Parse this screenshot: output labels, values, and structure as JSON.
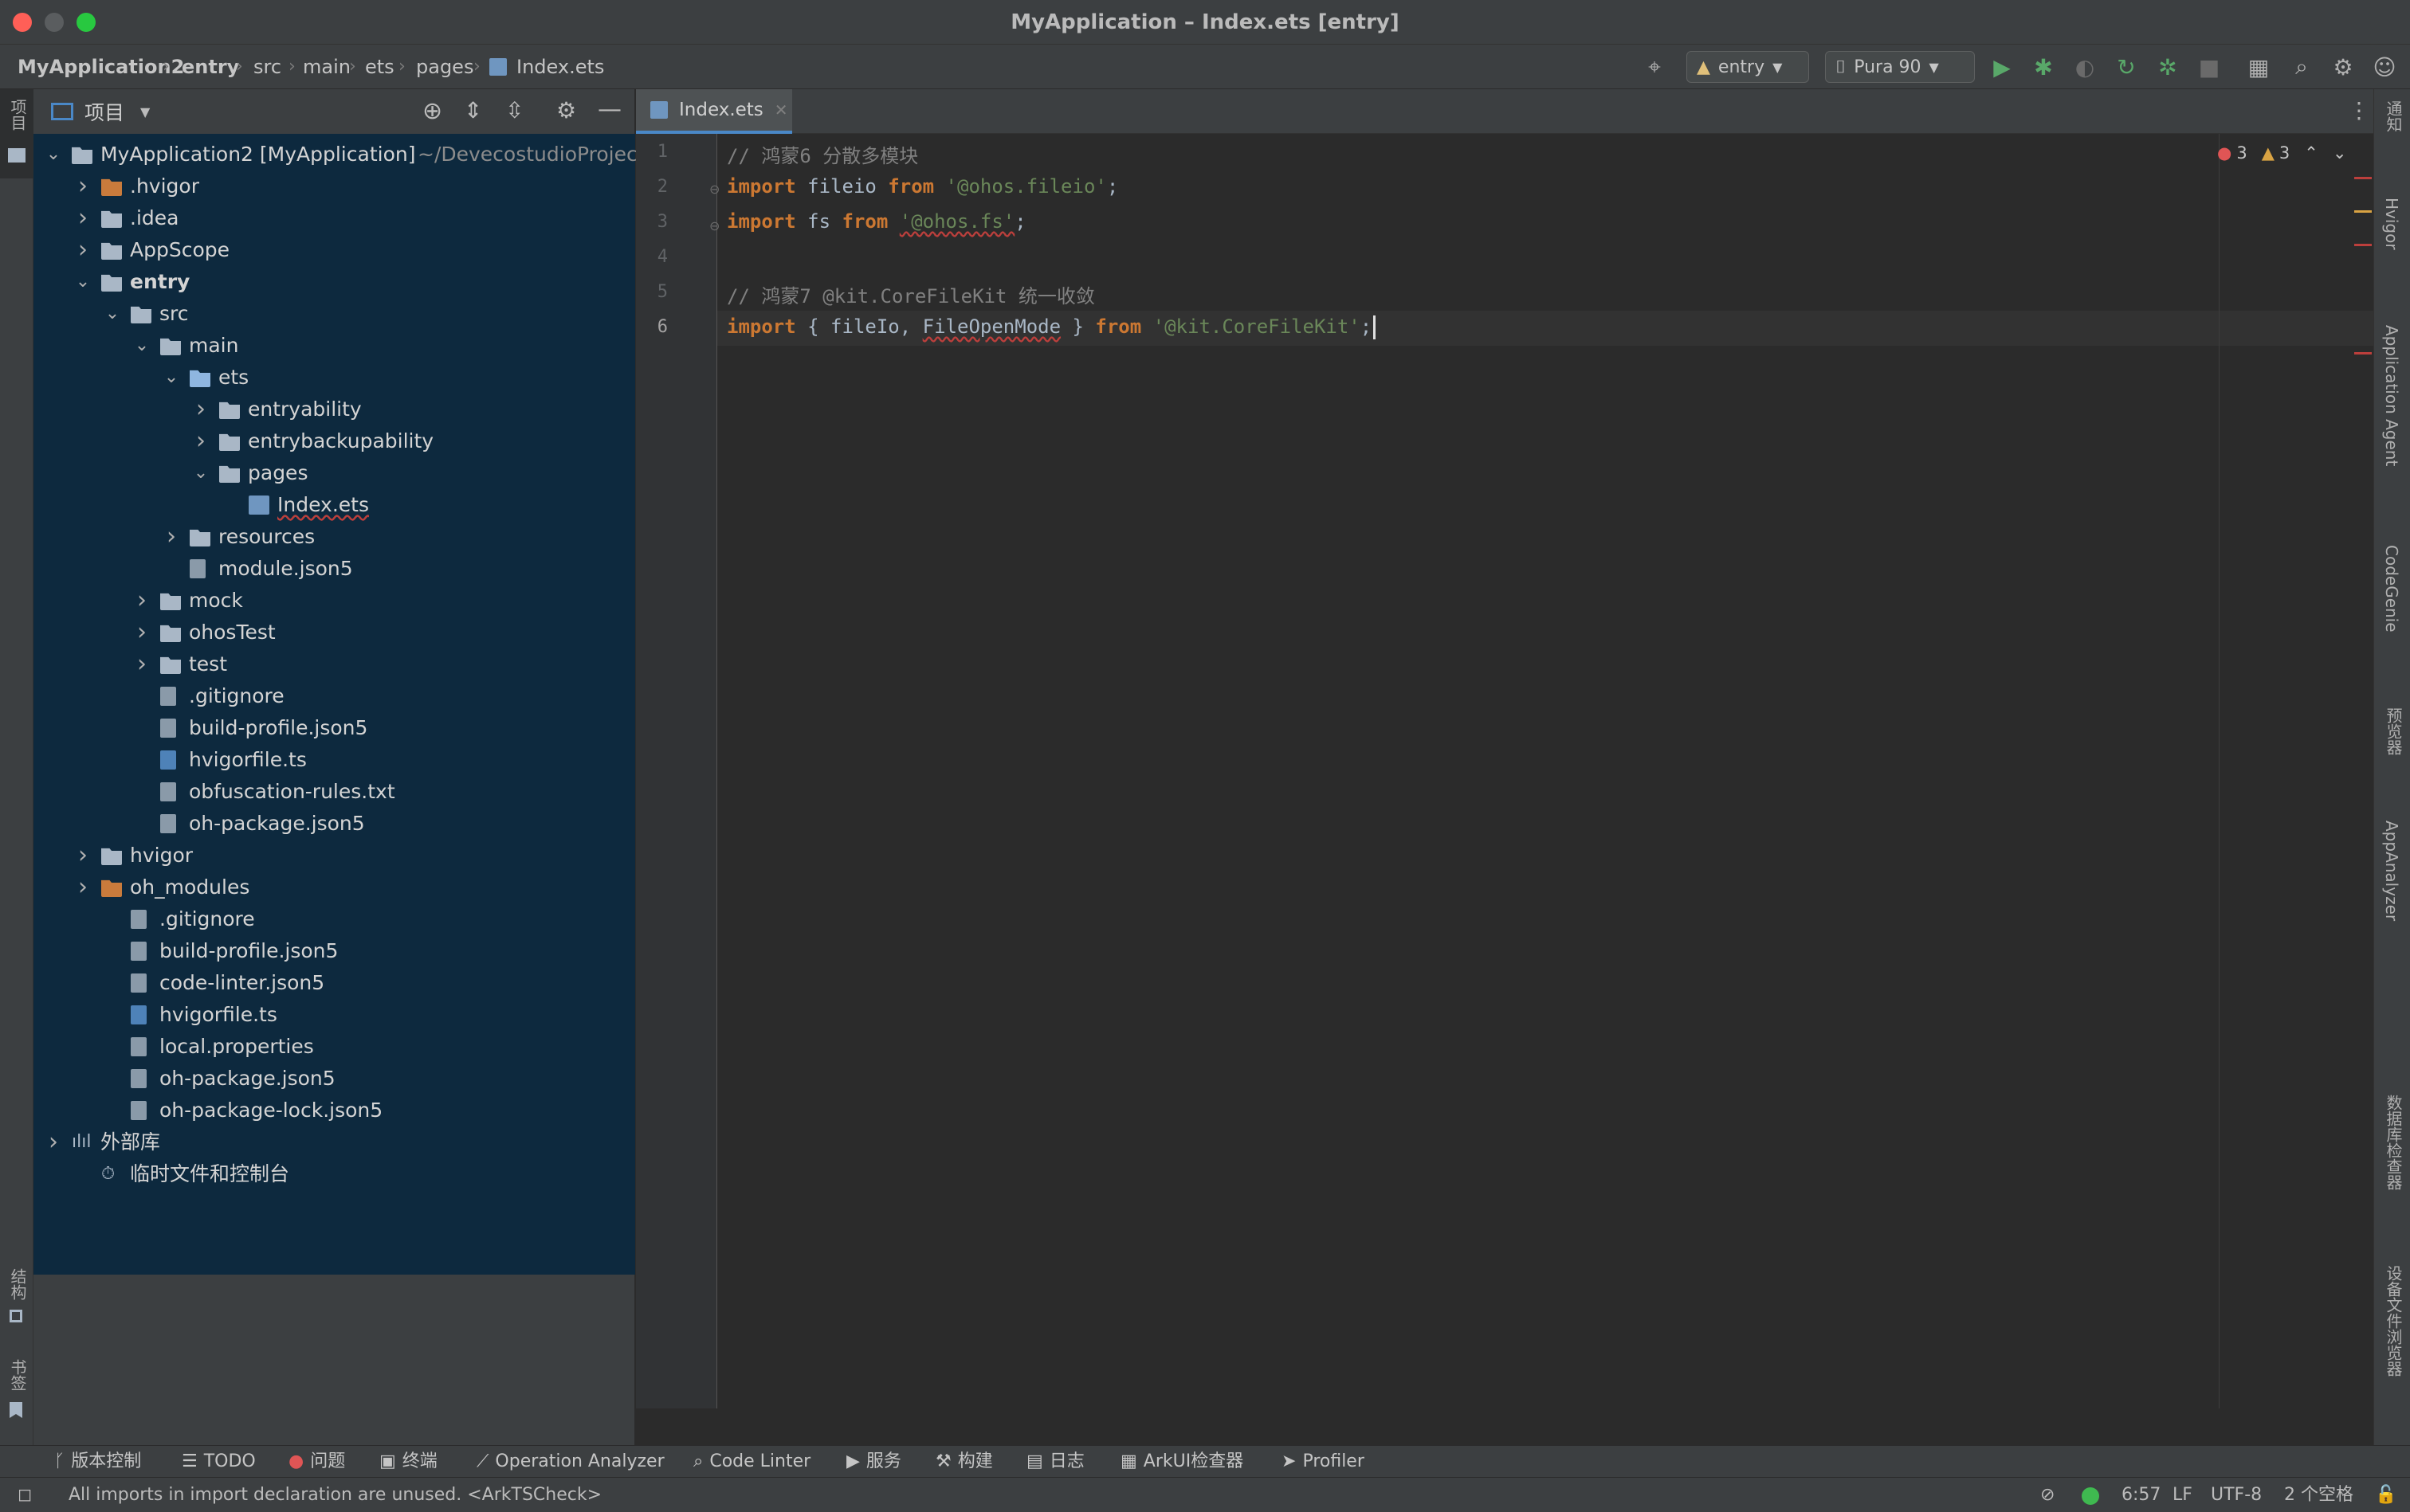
{
  "window": {
    "title": "MyApplication – Index.ets [entry]"
  },
  "breadcrumb": [
    "MyApplication2",
    "entry",
    "src",
    "main",
    "ets",
    "pages",
    "Index.ets"
  ],
  "toolbar": {
    "run_config": "entry",
    "device": "Pura 90"
  },
  "left_strip": {
    "project_label": "项目",
    "structure_label": "结构",
    "bookmarks_label": "书签"
  },
  "project_panel": {
    "view_selector": "项目",
    "tree": [
      {
        "label": "MyApplication2 [MyApplication]",
        "suffix": "~/DevecostudioProjects",
        "depth": 0,
        "chevron": "open",
        "icon": "module"
      },
      {
        "label": ".hvigor",
        "depth": 1,
        "chevron": "closed",
        "icon": "folder-orange"
      },
      {
        "label": ".idea",
        "depth": 1,
        "chevron": "closed",
        "icon": "folder"
      },
      {
        "label": "AppScope",
        "depth": 1,
        "chevron": "closed",
        "icon": "folder"
      },
      {
        "label": "entry",
        "depth": 1,
        "chevron": "open",
        "icon": "module",
        "bold": true
      },
      {
        "label": "src",
        "depth": 2,
        "chevron": "open",
        "icon": "folder"
      },
      {
        "label": "main",
        "depth": 3,
        "chevron": "open",
        "icon": "folder"
      },
      {
        "label": "ets",
        "depth": 4,
        "chevron": "open",
        "icon": "folder-blue"
      },
      {
        "label": "entryability",
        "depth": 5,
        "chevron": "closed",
        "icon": "folder"
      },
      {
        "label": "entrybackupability",
        "depth": 5,
        "chevron": "closed",
        "icon": "folder"
      },
      {
        "label": "pages",
        "depth": 5,
        "chevron": "open",
        "icon": "folder"
      },
      {
        "label": "Index.ets",
        "depth": 6,
        "chevron": "",
        "icon": "ets",
        "squiggle": true
      },
      {
        "label": "resources",
        "depth": 4,
        "chevron": "closed",
        "icon": "folder"
      },
      {
        "label": "module.json5",
        "depth": 4,
        "chevron": "",
        "icon": "file"
      },
      {
        "label": "mock",
        "depth": 3,
        "chevron": "closed",
        "icon": "folder"
      },
      {
        "label": "ohosTest",
        "depth": 3,
        "chevron": "closed",
        "icon": "folder"
      },
      {
        "label": "test",
        "depth": 3,
        "chevron": "closed",
        "icon": "folder"
      },
      {
        "label": ".gitignore",
        "depth": 3,
        "chevron": "",
        "icon": "file"
      },
      {
        "label": "build-profile.json5",
        "depth": 3,
        "chevron": "",
        "icon": "file"
      },
      {
        "label": "hvigorfile.ts",
        "depth": 3,
        "chevron": "",
        "icon": "ts"
      },
      {
        "label": "obfuscation-rules.txt",
        "depth": 3,
        "chevron": "",
        "icon": "file"
      },
      {
        "label": "oh-package.json5",
        "depth": 3,
        "chevron": "",
        "icon": "file"
      },
      {
        "label": "hvigor",
        "depth": 1,
        "chevron": "closed",
        "icon": "folder"
      },
      {
        "label": "oh_modules",
        "depth": 1,
        "chevron": "closed",
        "icon": "folder-orange"
      },
      {
        "label": ".gitignore",
        "depth": 2,
        "chevron": "",
        "icon": "file"
      },
      {
        "label": "build-profile.json5",
        "depth": 2,
        "chevron": "",
        "icon": "file"
      },
      {
        "label": "code-linter.json5",
        "depth": 2,
        "chevron": "",
        "icon": "file"
      },
      {
        "label": "hvigorfile.ts",
        "depth": 2,
        "chevron": "",
        "icon": "ts"
      },
      {
        "label": "local.properties",
        "depth": 2,
        "chevron": "",
        "icon": "file"
      },
      {
        "label": "oh-package.json5",
        "depth": 2,
        "chevron": "",
        "icon": "file"
      },
      {
        "label": "oh-package-lock.json5",
        "depth": 2,
        "chevron": "",
        "icon": "file"
      },
      {
        "label": "外部库",
        "depth": 0,
        "chevron": "closed",
        "icon": "library"
      },
      {
        "label": "临时文件和控制台",
        "depth": 1,
        "chevron": "",
        "icon": "scratch"
      }
    ]
  },
  "editor": {
    "tab_label": "Index.ets",
    "errors": "3",
    "warnings": "3",
    "lines": [
      {
        "n": "1",
        "text": "// 鸿蒙6 分散多模块"
      },
      {
        "n": "2",
        "text": "import fileio from '@ohos.fileio';"
      },
      {
        "n": "3",
        "text": "import fs from '@ohos.fs';"
      },
      {
        "n": "4",
        "text": ""
      },
      {
        "n": "5",
        "text": "// 鸿蒙7 @kit.CoreFileKit 统一收敛"
      },
      {
        "n": "6",
        "text": "import { fileIo, FileOpenMode } from '@kit.CoreFileKit';"
      }
    ]
  },
  "right_strip": [
    "通知",
    "Hvigor",
    "Application Agent",
    "CodeGenie",
    "预览器",
    "AppAnalyzer",
    "数据库检查器",
    "设备文件浏览器"
  ],
  "bottom_tools": [
    "版本控制",
    "TODO",
    "问题",
    "终端",
    "Operation Analyzer",
    "Code Linter",
    "服务",
    "构建",
    "日志",
    "ArkUI检查器",
    "Profiler"
  ],
  "status": {
    "message": "All imports in import declaration are unused. <ArkTSCheck>",
    "position": "6:57",
    "line_sep": "LF",
    "encoding": "UTF-8",
    "indent": "2 个空格"
  },
  "colors": {
    "accent": "#4a88c7",
    "tree_selection_bg": "#0d293e",
    "error": "#bc3f3c",
    "warning": "#d9a343"
  }
}
